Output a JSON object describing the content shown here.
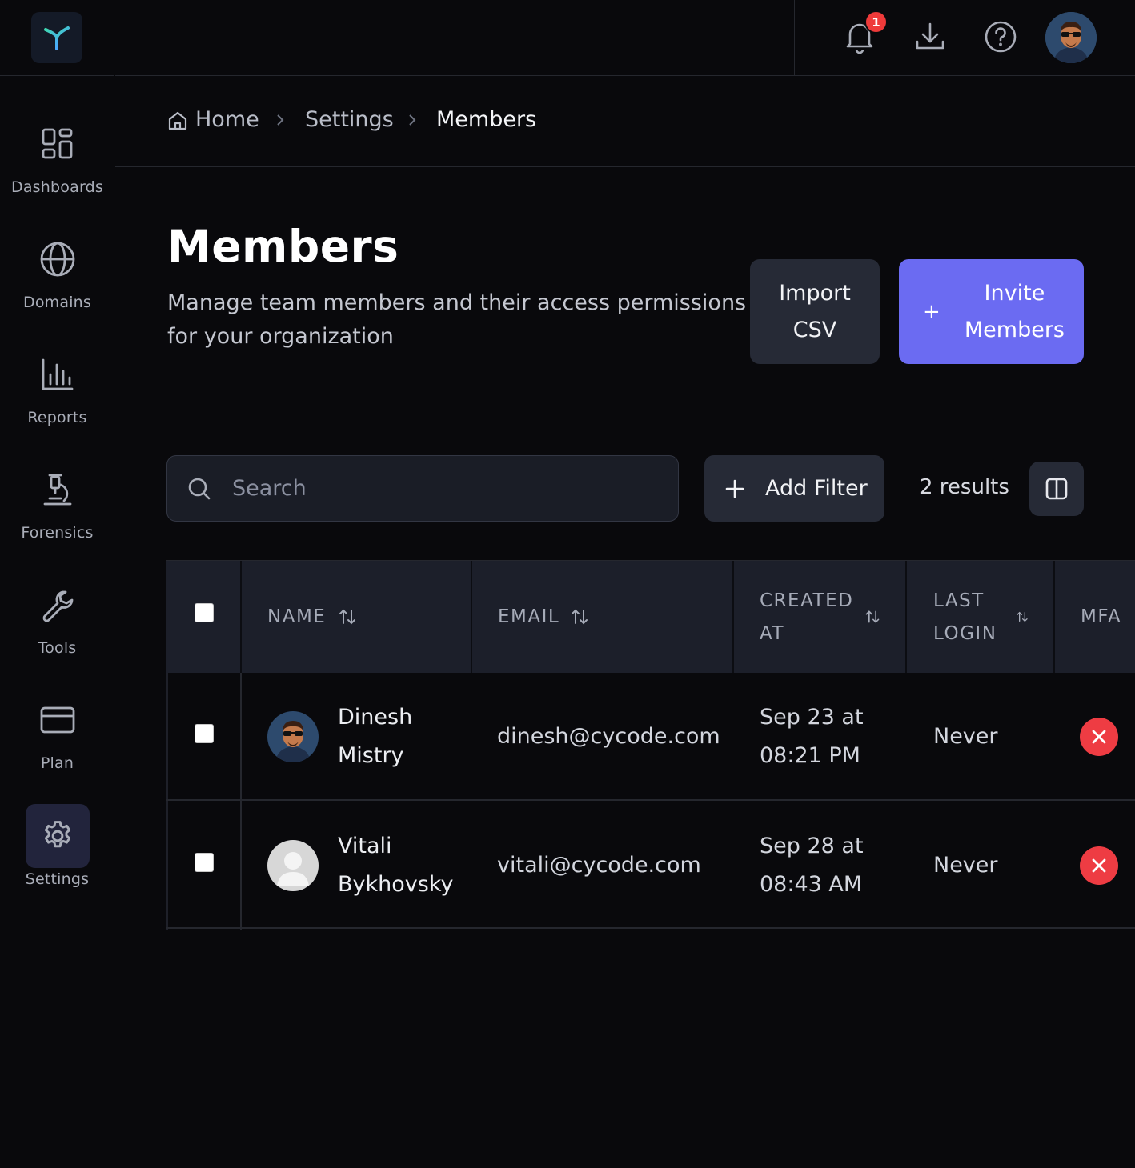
{
  "topbar": {
    "notification_count": "1"
  },
  "sidebar": {
    "items": [
      {
        "label": "Dashboards",
        "icon": "dashboards-icon"
      },
      {
        "label": "Domains",
        "icon": "globe-icon"
      },
      {
        "label": "Reports",
        "icon": "bar-chart-icon"
      },
      {
        "label": "Forensics",
        "icon": "microscope-icon"
      },
      {
        "label": "Tools",
        "icon": "wrench-icon"
      },
      {
        "label": "Plan",
        "icon": "credit-card-icon"
      },
      {
        "label": "Settings",
        "icon": "gear-icon",
        "active": true
      }
    ]
  },
  "breadcrumb": {
    "home": "Home",
    "settings": "Settings",
    "current": "Members"
  },
  "header": {
    "title": "Members",
    "description": "Manage team members and their access permissions for your organization",
    "import_label": "Import CSV",
    "invite_plus": "+",
    "invite_label": "Invite Members"
  },
  "toolbar": {
    "search_placeholder": "Search",
    "add_filter_label": "Add Filter",
    "results": "2 results"
  },
  "table": {
    "columns": {
      "name": "NAME",
      "email": "EMAIL",
      "created": "CREATED AT",
      "last_login": "LAST LOGIN",
      "mfa": "MFA"
    },
    "rows": [
      {
        "name": "Dinesh Mistry",
        "email": "dinesh@cycode.com",
        "created": "Sep 23 at 08:21 PM",
        "last_login": "Never",
        "mfa": "disabled"
      },
      {
        "name": "Vitali Bykhovsky",
        "email": "vitali@cycode.com",
        "created": "Sep 28 at 08:43 AM",
        "last_login": "Never",
        "mfa": "disabled"
      }
    ]
  },
  "colors": {
    "accent": "#6b6bf2",
    "danger": "#ee3c43",
    "background": "#09090c"
  }
}
